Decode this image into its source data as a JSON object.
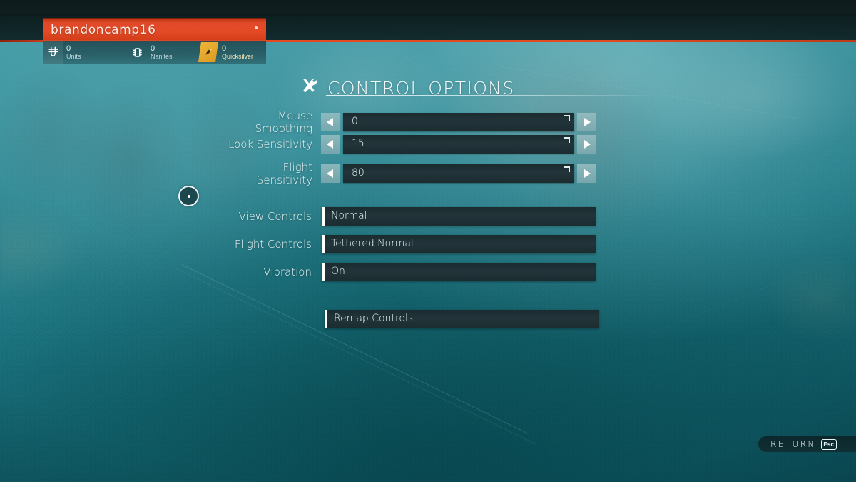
{
  "player": {
    "name": "brandoncamp16",
    "stats": [
      {
        "icon": "units-icon",
        "value": "0",
        "label": "Units"
      },
      {
        "icon": "nanites-icon",
        "value": "0",
        "label": "Nanites"
      },
      {
        "icon": "quicksilver-icon",
        "value": "0",
        "label": "Quicksilver"
      }
    ]
  },
  "header": {
    "icon": "tools-icon",
    "title": "CONTROL OPTIONS"
  },
  "slider_rows": [
    {
      "label": "Mouse Smoothing",
      "value": "0",
      "left_icon": "caret-left-icon",
      "right_icon": "caret-right-icon"
    },
    {
      "label": "Look Sensitivity",
      "value": "15",
      "left_icon": "caret-left-icon",
      "right_icon": "caret-right-icon"
    },
    {
      "label": "Flight Sensitivity",
      "value": "80",
      "left_icon": "caret-left-icon",
      "right_icon": "caret-right-icon"
    }
  ],
  "select_rows": [
    {
      "label": "View Controls",
      "value": "Normal"
    },
    {
      "label": "Flight Controls",
      "value": "Tethered Normal"
    },
    {
      "label": "Vibration",
      "value": "On"
    }
  ],
  "remap": {
    "label": "Remap Controls"
  },
  "footer": {
    "return_label": "RETURN",
    "key_label": "Esc"
  },
  "cursor": {
    "name": "circle-cursor"
  },
  "colors": {
    "accent_red": "#e0492a",
    "quicksilver_gold": "#f0b638",
    "field_dark": "#22353a",
    "background_teal": "#2b8490"
  }
}
